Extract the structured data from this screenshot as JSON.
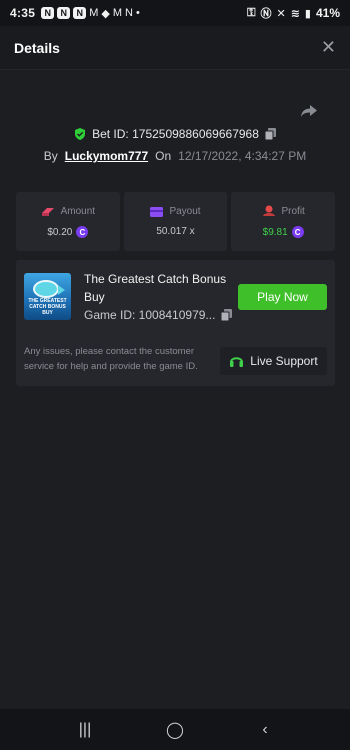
{
  "status": {
    "time": "4:35",
    "battery": "41%",
    "notif_letters": [
      "N",
      "N",
      "N",
      "M",
      "M",
      "N"
    ]
  },
  "header": {
    "title": "Details",
    "close_icon": "close-icon"
  },
  "bet": {
    "id_text": "Bet ID: 17525098860696679​68",
    "by_label": "By",
    "user": "Luckymom777",
    "on_label": "On",
    "date": "12/17/2022, 4:34:27 PM"
  },
  "stats": [
    {
      "label": "Amount",
      "value": "$0.20",
      "icon": "amount-icon",
      "color": "#e64a6a"
    },
    {
      "label": "Payout",
      "value": "50.017 x",
      "icon": "payout-card-icon",
      "color": "#8b4cf5"
    },
    {
      "label": "Profit",
      "value": "$9.81",
      "icon": "profit-icon",
      "color": "#e64a4a"
    }
  ],
  "game": {
    "name": "The Greatest Catch Bonus Buy",
    "id_text": "Game ID: 1008410979...",
    "play_label": "Play Now",
    "thumb_caption": "THE GREATEST CATCH BONUS BUY",
    "issues_text": "Any issues, please contact the customer service for help and provide the game ID.",
    "support_label": "Live Support"
  },
  "coin_symbol": "C",
  "colors": {
    "background": "#1d1e22",
    "card": "#25272c",
    "accent_green": "#3fbf2a",
    "profit_green": "#3fcf4a",
    "coin_purple": "#7a3cf0"
  }
}
